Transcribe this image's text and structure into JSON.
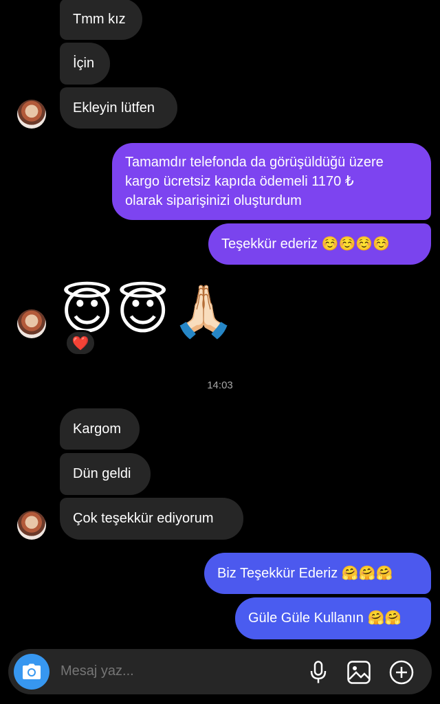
{
  "messages": [
    {
      "text": "Tmm kız"
    },
    {
      "text": "İçin"
    },
    {
      "text": "Ekleyin lütfen"
    },
    {
      "text": "Tamamdır telefonda da görüşüldüğü üzere"
    },
    {
      "text": "kargo ücretsiz kapıda ödemeli 1170 ₺"
    },
    {
      "text": "olarak siparişinizi oluşturdum"
    },
    {
      "text": "Teşekkür ederiz ☺️☺️☺️☺️"
    },
    {
      "text": "😇😇🙏🏻"
    },
    {
      "text": "❤️"
    },
    {
      "text": "Kargom"
    },
    {
      "text": "Dün geldi"
    },
    {
      "text": "Çok teşekkür ediyorum"
    },
    {
      "text": "Biz Teşekkür Ederiz 🤗🤗🤗"
    },
    {
      "text": "Güle Güle Kullanın 🤗🤗"
    }
  ],
  "timestamp": "14:03",
  "composer": {
    "placeholder": "Mesaj yaz..."
  },
  "colors": {
    "incoming_bubble": "#262626",
    "outgoing_purple": "#7b3ff2",
    "outgoing_blue": "#4a5cf0",
    "camera_button": "#3797f0"
  },
  "icons": [
    "camera-icon",
    "microphone-icon",
    "gallery-icon",
    "add-icon"
  ]
}
